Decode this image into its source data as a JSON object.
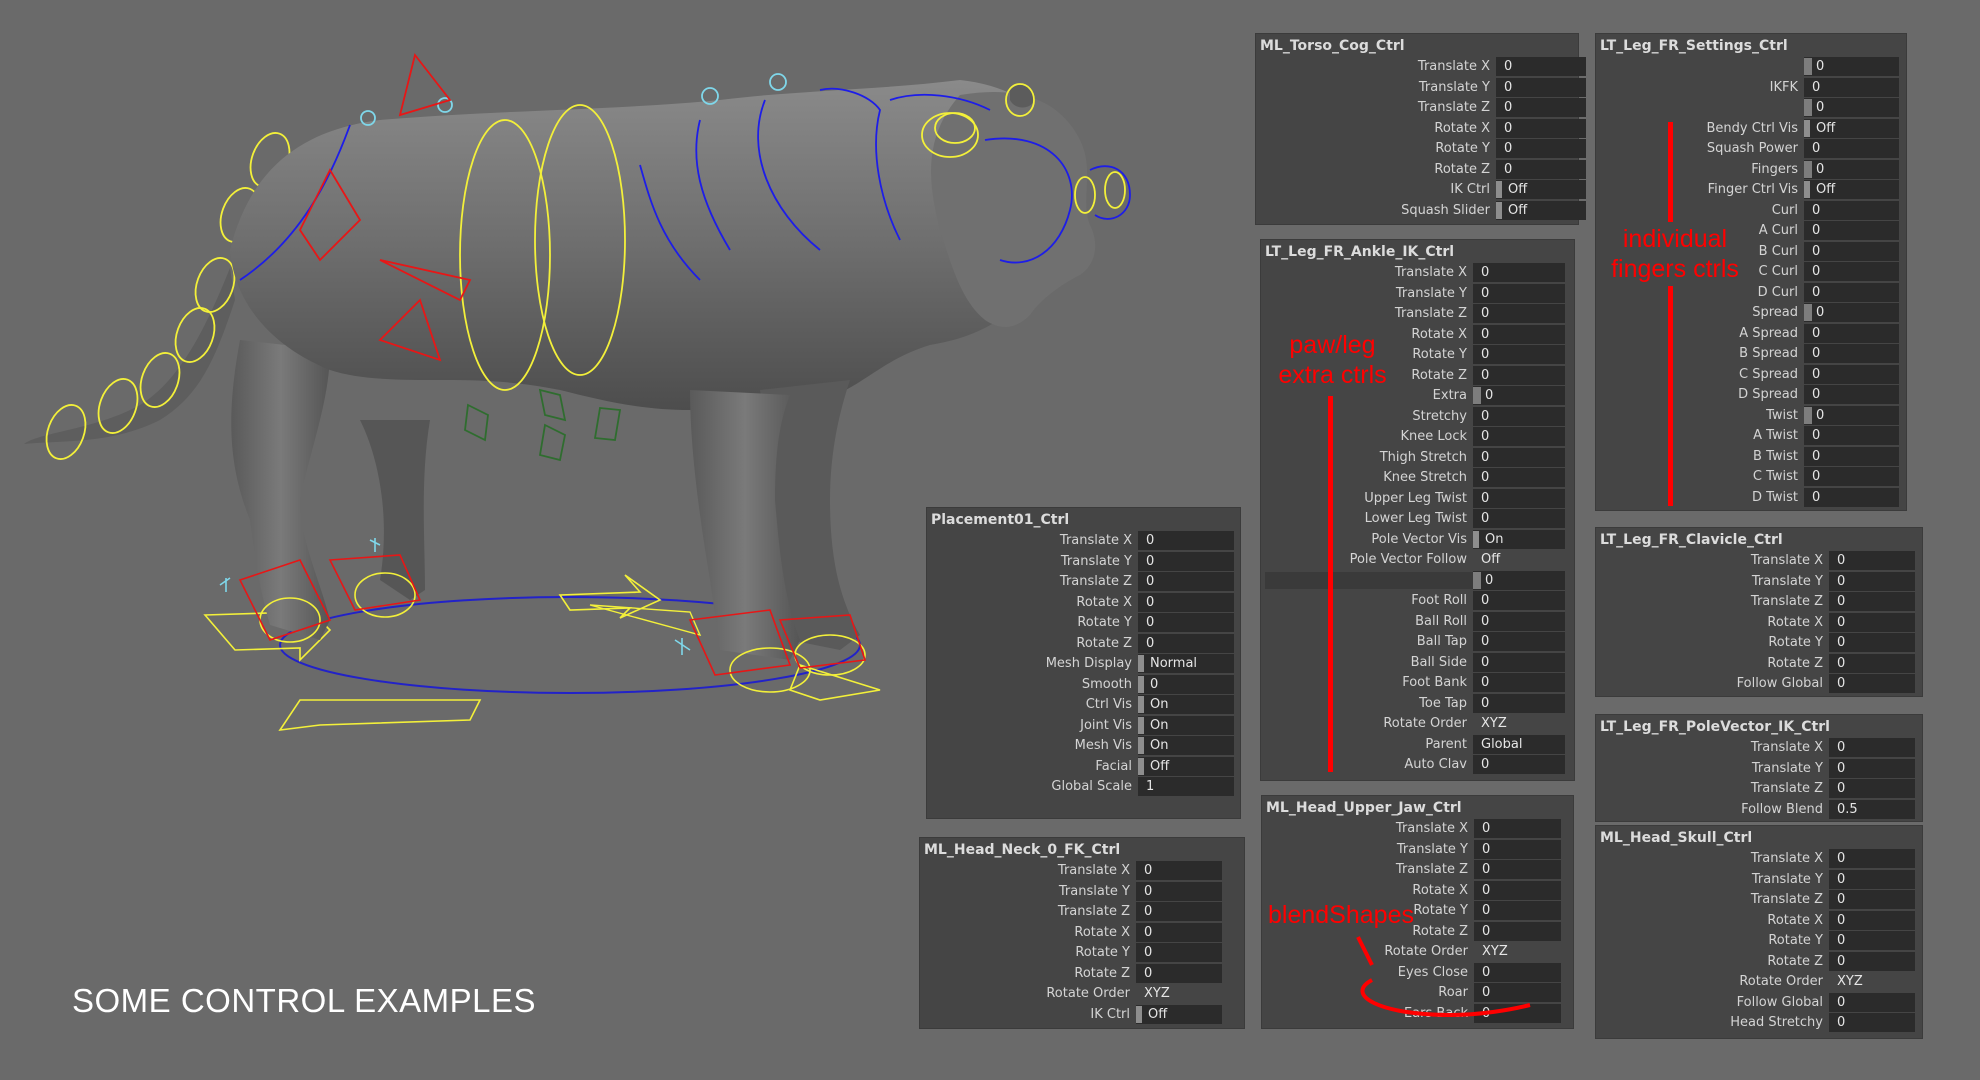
{
  "caption": "SOME CONTROL EXAMPLES",
  "annotations": {
    "fingers": "individual\nfingers ctrls",
    "paw": "paw/leg\nextra ctrls",
    "blendshapes": "blendShapes"
  },
  "colors": {
    "annotation": "#ff0000",
    "ctrl_yellow": "#f3f03a",
    "ctrl_blue": "#1d1de8",
    "ctrl_red": "#e81616",
    "ctrl_cyan": "#7fd7ea",
    "ctrl_green": "#2f6d2f"
  },
  "panels": {
    "torso": {
      "title": "ML_Torso_Cog_Ctrl",
      "rows": [
        {
          "label": "Translate X",
          "value": "0"
        },
        {
          "label": "Translate Y",
          "value": "0"
        },
        {
          "label": "Translate Z",
          "value": "0"
        },
        {
          "label": "Rotate X",
          "value": "0"
        },
        {
          "label": "Rotate Y",
          "value": "0"
        },
        {
          "label": "Rotate Z",
          "value": "0"
        },
        {
          "label": "IK Ctrl",
          "value": "Off",
          "kind": "tog"
        },
        {
          "label": "Squash Slider",
          "value": "Off",
          "kind": "tog"
        }
      ]
    },
    "settings": {
      "title": "LT_Leg_FR_Settings_Ctrl",
      "rows": [
        {
          "label": "",
          "value": "0",
          "kind": "slider"
        },
        {
          "label": "IKFK",
          "value": "0"
        },
        {
          "label": "",
          "value": "0",
          "kind": "slider"
        },
        {
          "label": "Bendy Ctrl Vis",
          "value": "Off",
          "kind": "tog"
        },
        {
          "label": "Squash Power",
          "value": "0"
        },
        {
          "label": "Fingers",
          "value": "0",
          "kind": "slider"
        },
        {
          "label": "Finger Ctrl Vis",
          "value": "Off",
          "kind": "tog"
        },
        {
          "label": "Curl",
          "value": "0"
        },
        {
          "label": "A Curl",
          "value": "0"
        },
        {
          "label": "B Curl",
          "value": "0"
        },
        {
          "label": "C Curl",
          "value": "0"
        },
        {
          "label": "D Curl",
          "value": "0"
        },
        {
          "label": "Spread",
          "value": "0",
          "kind": "slider"
        },
        {
          "label": "A Spread",
          "value": "0"
        },
        {
          "label": "B Spread",
          "value": "0"
        },
        {
          "label": "C Spread",
          "value": "0"
        },
        {
          "label": "D Spread",
          "value": "0"
        },
        {
          "label": "Twist",
          "value": "0",
          "kind": "slider"
        },
        {
          "label": "A Twist",
          "value": "0"
        },
        {
          "label": "B Twist",
          "value": "0"
        },
        {
          "label": "C Twist",
          "value": "0"
        },
        {
          "label": "D Twist",
          "value": "0"
        }
      ]
    },
    "ankle": {
      "title": "LT_Leg_FR_Ankle_IK_Ctrl",
      "rows": [
        {
          "label": "Translate X",
          "value": "0"
        },
        {
          "label": "Translate Y",
          "value": "0"
        },
        {
          "label": "Translate Z",
          "value": "0"
        },
        {
          "label": "Rotate X",
          "value": "0"
        },
        {
          "label": "Rotate Y",
          "value": "0"
        },
        {
          "label": "Rotate Z",
          "value": "0"
        },
        {
          "label": "Extra",
          "value": "0",
          "kind": "slider"
        },
        {
          "label": "Stretchy",
          "value": "0"
        },
        {
          "label": "Knee Lock",
          "value": "0"
        },
        {
          "label": "Thigh Stretch",
          "value": "0"
        },
        {
          "label": "Knee Stretch",
          "value": "0"
        },
        {
          "label": "Upper Leg Twist",
          "value": "0"
        },
        {
          "label": "Lower Leg Twist",
          "value": "0"
        },
        {
          "label": "Pole Vector Vis",
          "value": "On",
          "kind": "tog"
        },
        {
          "label": "Pole Vector Follow",
          "value": "Off",
          "kind": "plain"
        },
        {
          "label": "",
          "value": "0",
          "kind": "sep"
        },
        {
          "label": "Foot Roll",
          "value": "0"
        },
        {
          "label": "Ball Roll",
          "value": "0"
        },
        {
          "label": "Ball Tap",
          "value": "0"
        },
        {
          "label": "Ball Side",
          "value": "0"
        },
        {
          "label": "Foot Bank",
          "value": "0"
        },
        {
          "label": "Toe Tap",
          "value": "0"
        },
        {
          "label": "Rotate Order",
          "value": "XYZ",
          "kind": "plain"
        },
        {
          "label": "Parent",
          "value": "Global"
        },
        {
          "label": "Auto Clav",
          "value": "0"
        }
      ]
    },
    "clavicle": {
      "title": "LT_Leg_FR_Clavicle_Ctrl",
      "rows": [
        {
          "label": "Translate X",
          "value": "0"
        },
        {
          "label": "Translate Y",
          "value": "0"
        },
        {
          "label": "Translate Z",
          "value": "0"
        },
        {
          "label": "Rotate X",
          "value": "0"
        },
        {
          "label": "Rotate Y",
          "value": "0"
        },
        {
          "label": "Rotate Z",
          "value": "0"
        },
        {
          "label": "Follow Global",
          "value": "0"
        }
      ]
    },
    "polevector": {
      "title": "LT_Leg_FR_PoleVector_IK_Ctrl",
      "rows": [
        {
          "label": "Translate X",
          "value": "0"
        },
        {
          "label": "Translate Y",
          "value": "0"
        },
        {
          "label": "Translate Z",
          "value": "0"
        },
        {
          "label": "Follow Blend",
          "value": "0.5"
        }
      ]
    },
    "placement": {
      "title": "Placement01_Ctrl",
      "rows": [
        {
          "label": "Translate X",
          "value": "0"
        },
        {
          "label": "Translate Y",
          "value": "0"
        },
        {
          "label": "Translate Z",
          "value": "0"
        },
        {
          "label": "Rotate X",
          "value": "0"
        },
        {
          "label": "Rotate Y",
          "value": "0"
        },
        {
          "label": "Rotate Z",
          "value": "0"
        },
        {
          "label": "Mesh Display",
          "value": "Normal",
          "kind": "tog"
        },
        {
          "label": "Smooth",
          "value": "0",
          "kind": "tog"
        },
        {
          "label": "Ctrl Vis",
          "value": "On",
          "kind": "tog"
        },
        {
          "label": "Joint Vis",
          "value": "On",
          "kind": "tog"
        },
        {
          "label": "Mesh Vis",
          "value": "On",
          "kind": "tog"
        },
        {
          "label": "Facial",
          "value": "Off",
          "kind": "tog"
        },
        {
          "label": "Global Scale",
          "value": "1"
        }
      ]
    },
    "neck": {
      "title": "ML_Head_Neck_0_FK_Ctrl",
      "rows": [
        {
          "label": "Translate X",
          "value": "0"
        },
        {
          "label": "Translate Y",
          "value": "0"
        },
        {
          "label": "Translate Z",
          "value": "0"
        },
        {
          "label": "Rotate X",
          "value": "0"
        },
        {
          "label": "Rotate Y",
          "value": "0"
        },
        {
          "label": "Rotate Z",
          "value": "0"
        },
        {
          "label": "Rotate Order",
          "value": "XYZ",
          "kind": "plain"
        },
        {
          "label": "IK Ctrl",
          "value": "Off",
          "kind": "tog"
        }
      ]
    },
    "jaw": {
      "title": "ML_Head_Upper_Jaw_Ctrl",
      "rows": [
        {
          "label": "Translate X",
          "value": "0"
        },
        {
          "label": "Translate Y",
          "value": "0"
        },
        {
          "label": "Translate Z",
          "value": "0"
        },
        {
          "label": "Rotate X",
          "value": "0"
        },
        {
          "label": "Rotate Y",
          "value": "0"
        },
        {
          "label": "Rotate Z",
          "value": "0"
        },
        {
          "label": "Rotate Order",
          "value": "XYZ",
          "kind": "plain"
        },
        {
          "label": "Eyes Close",
          "value": "0"
        },
        {
          "label": "Roar",
          "value": "0"
        },
        {
          "label": "Ears Back",
          "value": "0"
        }
      ]
    },
    "skull": {
      "title": "ML_Head_Skull_Ctrl",
      "rows": [
        {
          "label": "Translate X",
          "value": "0"
        },
        {
          "label": "Translate Y",
          "value": "0"
        },
        {
          "label": "Translate Z",
          "value": "0"
        },
        {
          "label": "Rotate X",
          "value": "0"
        },
        {
          "label": "Rotate Y",
          "value": "0"
        },
        {
          "label": "Rotate Z",
          "value": "0"
        },
        {
          "label": "Rotate Order",
          "value": "XYZ",
          "kind": "plain"
        },
        {
          "label": "Follow Global",
          "value": "0"
        },
        {
          "label": "Head Stretchy",
          "value": "0"
        }
      ]
    }
  }
}
